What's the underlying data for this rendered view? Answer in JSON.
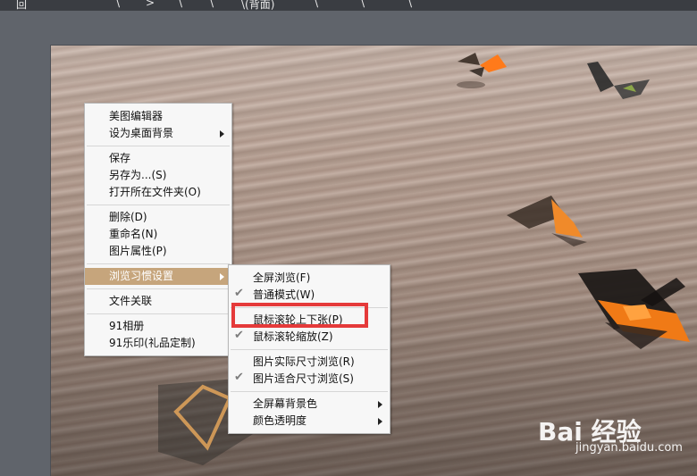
{
  "topbar": {
    "fragments": [
      "回",
      "\\",
      ">",
      "\\",
      "\\",
      "\\(背面)",
      "\\",
      "\\",
      "\\"
    ]
  },
  "context_menu": {
    "items": [
      {
        "label": "美图编辑器",
        "has_submenu": false
      },
      {
        "label": "设为桌面背景",
        "has_submenu": true
      },
      {
        "label": "保存",
        "has_submenu": false
      },
      {
        "label": "另存为...(S)",
        "has_submenu": false
      },
      {
        "label": "打开所在文件夹(O)",
        "has_submenu": false
      },
      {
        "label": "删除(D)",
        "has_submenu": false
      },
      {
        "label": "重命名(N)",
        "has_submenu": false
      },
      {
        "label": "图片属性(P)",
        "has_submenu": false
      },
      {
        "label": "浏览习惯设置",
        "has_submenu": true,
        "highlighted": true
      },
      {
        "label": "文件关联",
        "has_submenu": false
      },
      {
        "label": "91相册",
        "has_submenu": false
      },
      {
        "label": "91乐印(礼品定制)",
        "has_submenu": false
      }
    ]
  },
  "submenu": {
    "items": [
      {
        "label": "全屏浏览(F)",
        "checked": false,
        "has_submenu": false
      },
      {
        "label": "普通模式(W)",
        "checked": true,
        "has_submenu": false
      },
      {
        "label": "鼠标滚轮上下张(P)",
        "checked": false,
        "has_submenu": false
      },
      {
        "label": "鼠标滚轮缩放(Z)",
        "checked": true,
        "has_submenu": false
      },
      {
        "label": "图片实际尺寸浏览(R)",
        "checked": false,
        "has_submenu": false
      },
      {
        "label": "图片适合尺寸浏览(S)",
        "checked": true,
        "has_submenu": false
      },
      {
        "label": "全屏幕背景色",
        "checked": false,
        "has_submenu": true
      },
      {
        "label": "颜色透明度",
        "checked": false,
        "has_submenu": true
      }
    ]
  },
  "watermark": {
    "brand": "Bai 经验",
    "url": "jingyan.baidu.com"
  },
  "colors": {
    "menu_bg": "#f7f7f7",
    "highlight": "#c6a57c",
    "redbox": "#e53a3a",
    "viewer_bg": "#60646b"
  }
}
